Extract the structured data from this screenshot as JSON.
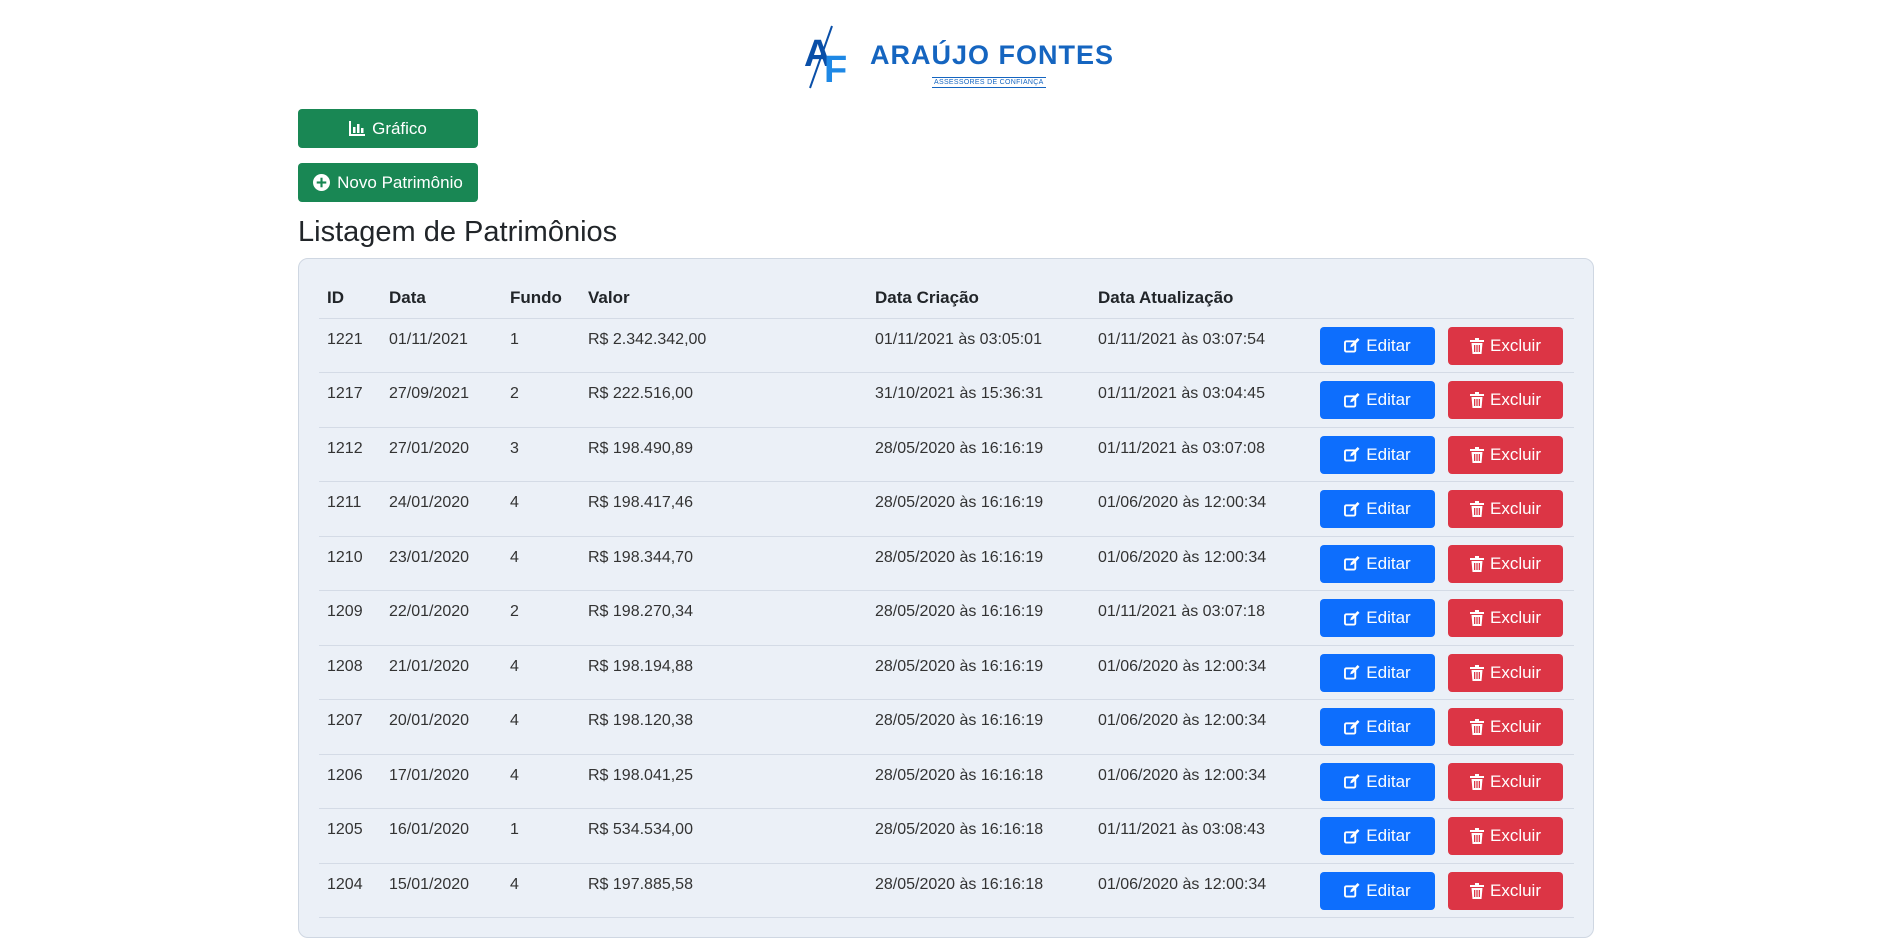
{
  "brand": {
    "name": "ARAÚJO FONTES",
    "tagline": "ASSESSORES DE CONFIANÇA",
    "color": "#1565c0"
  },
  "toolbar": {
    "chart_label": "Gráfico",
    "chart_icon": "bar-chart-icon",
    "new_label": "Novo Patrimônio",
    "new_icon": "plus-circle-icon"
  },
  "page": {
    "title": "Listagem de Patrimônios"
  },
  "table": {
    "headers": {
      "id": "ID",
      "data": "Data",
      "fundo": "Fundo",
      "valor": "Valor",
      "criacao": "Data Criação",
      "atualizacao": "Data Atualização"
    },
    "actions": {
      "edit_label": "Editar",
      "edit_icon": "edit-icon",
      "edit_color": "#0d6efd",
      "delete_label": "Excluir",
      "delete_icon": "trash-icon",
      "delete_color": "#dc3545"
    },
    "rows": [
      {
        "id": "1221",
        "data": "01/11/2021",
        "fundo": "1",
        "valor": "R$ 2.342.342,00",
        "criacao": "01/11/2021 às 03:05:01",
        "atualizacao": "01/11/2021 às 03:07:54"
      },
      {
        "id": "1217",
        "data": "27/09/2021",
        "fundo": "2",
        "valor": "R$ 222.516,00",
        "criacao": "31/10/2021 às 15:36:31",
        "atualizacao": "01/11/2021 às 03:04:45"
      },
      {
        "id": "1212",
        "data": "27/01/2020",
        "fundo": "3",
        "valor": "R$ 198.490,89",
        "criacao": "28/05/2020 às 16:16:19",
        "atualizacao": "01/11/2021 às 03:07:08"
      },
      {
        "id": "1211",
        "data": "24/01/2020",
        "fundo": "4",
        "valor": "R$ 198.417,46",
        "criacao": "28/05/2020 às 16:16:19",
        "atualizacao": "01/06/2020 às 12:00:34"
      },
      {
        "id": "1210",
        "data": "23/01/2020",
        "fundo": "4",
        "valor": "R$ 198.344,70",
        "criacao": "28/05/2020 às 16:16:19",
        "atualizacao": "01/06/2020 às 12:00:34"
      },
      {
        "id": "1209",
        "data": "22/01/2020",
        "fundo": "2",
        "valor": "R$ 198.270,34",
        "criacao": "28/05/2020 às 16:16:19",
        "atualizacao": "01/11/2021 às 03:07:18"
      },
      {
        "id": "1208",
        "data": "21/01/2020",
        "fundo": "4",
        "valor": "R$ 198.194,88",
        "criacao": "28/05/2020 às 16:16:19",
        "atualizacao": "01/06/2020 às 12:00:34"
      },
      {
        "id": "1207",
        "data": "20/01/2020",
        "fundo": "4",
        "valor": "R$ 198.120,38",
        "criacao": "28/05/2020 às 16:16:19",
        "atualizacao": "01/06/2020 às 12:00:34"
      },
      {
        "id": "1206",
        "data": "17/01/2020",
        "fundo": "4",
        "valor": "R$ 198.041,25",
        "criacao": "28/05/2020 às 16:16:18",
        "atualizacao": "01/06/2020 às 12:00:34"
      },
      {
        "id": "1205",
        "data": "16/01/2020",
        "fundo": "1",
        "valor": "R$ 534.534,00",
        "criacao": "28/05/2020 às 16:16:18",
        "atualizacao": "01/11/2021 às 03:08:43"
      },
      {
        "id": "1204",
        "data": "15/01/2020",
        "fundo": "4",
        "valor": "R$ 197.885,58",
        "criacao": "28/05/2020 às 16:16:18",
        "atualizacao": "01/06/2020 às 12:00:34"
      }
    ]
  }
}
